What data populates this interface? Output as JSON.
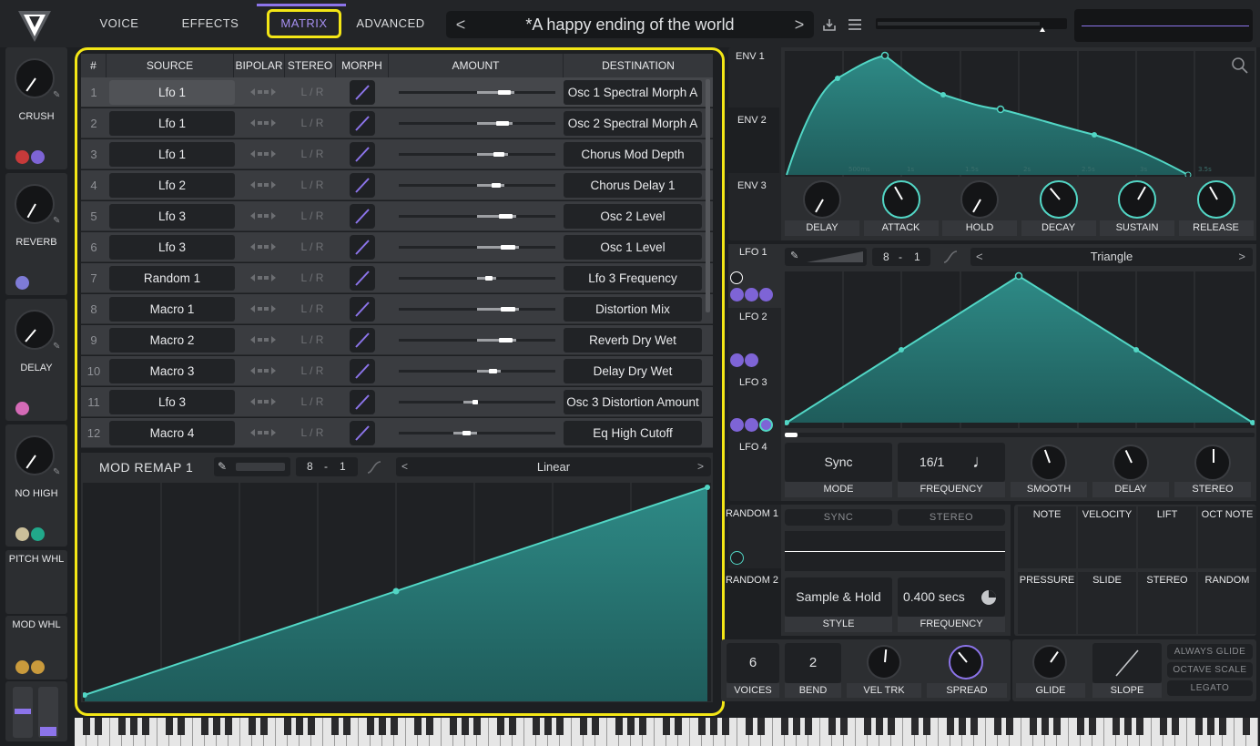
{
  "nav": {
    "tabs": [
      "VOICE",
      "EFFECTS",
      "MATRIX",
      "ADVANCED"
    ],
    "active_tab": "MATRIX"
  },
  "preset": {
    "name": "*A happy ending of the world",
    "prev": "<",
    "next": ">"
  },
  "colors": {
    "accent": "#8c74ea",
    "teal": "#52d6c5",
    "highlight": "#f3e616"
  },
  "sidebar": [
    {
      "label": "CRUSH"
    },
    {
      "label": "REVERB"
    },
    {
      "label": "DELAY"
    },
    {
      "label": "NO HIGH"
    },
    {
      "label": "PITCH WHL"
    },
    {
      "label": "MOD WHL"
    }
  ],
  "matrix": {
    "headers": [
      "#",
      "SOURCE",
      "BIPOLAR",
      "STEREO",
      "MORPH",
      "AMOUNT",
      "DESTINATION"
    ],
    "rows": [
      {
        "num": "1",
        "source": "Lfo 1",
        "stereo": "L / R",
        "amount": 0.48,
        "destination": "Osc 1 Spectral Morph A"
      },
      {
        "num": "2",
        "source": "Lfo 1",
        "stereo": "L / R",
        "amount": 0.45,
        "destination": "Osc 2 Spectral Morph A"
      },
      {
        "num": "3",
        "source": "Lfo 1",
        "stereo": "L / R",
        "amount": 0.4,
        "destination": "Chorus Mod Depth"
      },
      {
        "num": "4",
        "source": "Lfo 2",
        "stereo": "L / R",
        "amount": 0.35,
        "destination": "Chorus Delay 1"
      },
      {
        "num": "5",
        "source": "Lfo 3",
        "stereo": "L / R",
        "amount": 0.5,
        "destination": "Osc 2 Level"
      },
      {
        "num": "6",
        "source": "Lfo 3",
        "stereo": "L / R",
        "amount": 0.53,
        "destination": "Osc 1 Level"
      },
      {
        "num": "7",
        "source": "Random 1",
        "stereo": "L / R",
        "amount": 0.24,
        "destination": "Lfo 3 Frequency"
      },
      {
        "num": "8",
        "source": "Macro 1",
        "stereo": "L / R",
        "amount": 0.53,
        "destination": "Distortion Mix"
      },
      {
        "num": "9",
        "source": "Macro 2",
        "stereo": "L / R",
        "amount": 0.5,
        "destination": "Reverb Dry Wet"
      },
      {
        "num": "10",
        "source": "Macro 3",
        "stereo": "L / R",
        "amount": 0.3,
        "destination": "Delay Dry Wet"
      },
      {
        "num": "11",
        "source": "Lfo 3",
        "stereo": "L / R",
        "amount": -0.17,
        "destination": "Osc 3 Distortion Amount"
      },
      {
        "num": "12",
        "source": "Macro 4",
        "stereo": "L / R",
        "amount": -0.3,
        "destination": "Eq High Cutoff"
      }
    ]
  },
  "remap": {
    "title": "MOD REMAP 1",
    "grid_a": "8",
    "grid_sep": "-",
    "grid_b": "1",
    "shape": "Linear",
    "prev": "<",
    "next": ">"
  },
  "env": {
    "tabs": [
      "ENV 1",
      "ENV 2",
      "ENV 3"
    ],
    "time_labels": [
      "500ms",
      "1s",
      "1.5s",
      "2s",
      "2.5s",
      "3s",
      "3.5s"
    ],
    "knobs": [
      "DELAY",
      "ATTACK",
      "HOLD",
      "DECAY",
      "SUSTAIN",
      "RELEASE"
    ]
  },
  "lfo": {
    "tabs": [
      "LFO 1",
      "LFO 2",
      "LFO 3",
      "LFO 4"
    ],
    "grid_a": "8",
    "grid_sep": "-",
    "grid_b": "1",
    "shape": "Triangle",
    "prev": "<",
    "next": ">",
    "mode_value": "Sync",
    "mode_label": "MODE",
    "frequency_value": "16/1",
    "frequency_label": "FREQUENCY",
    "knobs": [
      "SMOOTH",
      "DELAY",
      "STEREO"
    ]
  },
  "random": {
    "tabs": [
      "RANDOM 1",
      "RANDOM 2"
    ],
    "sync": "SYNC",
    "stereo": "STEREO",
    "style_value": "Sample & Hold",
    "style_label": "STYLE",
    "frequency_value": "0.400 secs",
    "frequency_label": "FREQUENCY"
  },
  "sources": {
    "row1": [
      "NOTE",
      "VELOCITY",
      "LIFT",
      "OCT NOTE"
    ],
    "row2": [
      "PRESSURE",
      "SLIDE",
      "STEREO",
      "RANDOM"
    ]
  },
  "voice": {
    "voices_value": "6",
    "voices_label": "VOICES",
    "bend_value": "2",
    "bend_label": "BEND",
    "veltrk_label": "VEL TRK",
    "spread_label": "SPREAD",
    "glide_label": "GLIDE",
    "slope_label": "SLOPE",
    "always_glide": "ALWAYS GLIDE",
    "octave_scale": "OCTAVE SCALE",
    "legato": "LEGATO"
  }
}
